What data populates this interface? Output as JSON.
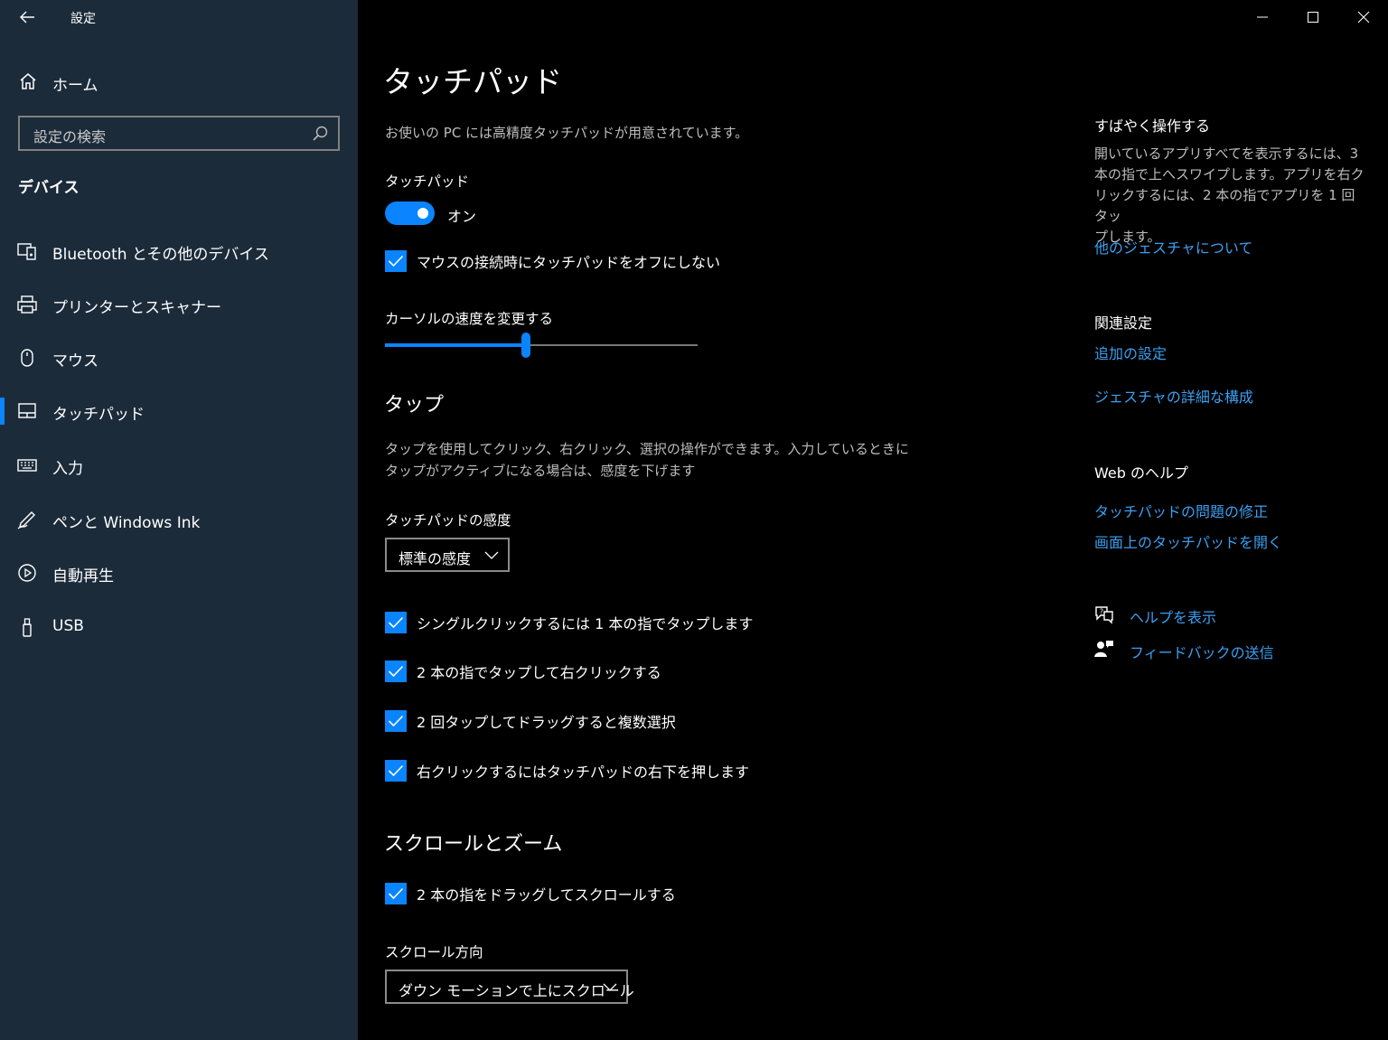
{
  "window": {
    "app_title": "設定"
  },
  "sidebar": {
    "home_label": "ホーム",
    "search_placeholder": "設定の検索",
    "section_title": "デバイス",
    "items": [
      {
        "label": "Bluetooth とその他のデバイス",
        "icon": "bluetooth-device-icon"
      },
      {
        "label": "プリンターとスキャナー",
        "icon": "printer-icon"
      },
      {
        "label": "マウス",
        "icon": "mouse-icon"
      },
      {
        "label": "タッチパッド",
        "icon": "touchpad-icon",
        "selected": true
      },
      {
        "label": "入力",
        "icon": "keyboard-icon"
      },
      {
        "label": "ペンと Windows Ink",
        "icon": "pen-icon"
      },
      {
        "label": "自動再生",
        "icon": "autoplay-icon"
      },
      {
        "label": "USB",
        "icon": "usb-icon"
      }
    ]
  },
  "main": {
    "title": "タッチパッド",
    "precision_note": "お使いの PC には高精度タッチパッドが用意されています。",
    "touchpad_label": "タッチパッド",
    "toggle_state": "オン",
    "keep_on_with_mouse": "マウスの接続時にタッチパッドをオフにしない",
    "cursor_speed_label": "カーソルの速度を変更する",
    "cursor_speed_fraction": 0.45,
    "taps": {
      "heading": "タップ",
      "desc_line1": "タップを使用してクリック、右クリック、選択の操作ができます。入力しているときに",
      "desc_line2": "タップがアクティブになる場合は、感度を下げます",
      "sensitivity_label": "タッチパッドの感度",
      "sensitivity_value": "標準の感度",
      "options": [
        "シングルクリックするには 1 本の指でタップします",
        "2 本の指でタップして右クリックする",
        "2 回タップしてドラッグすると複数選択",
        "右クリックするにはタッチパッドの右下を押します"
      ]
    },
    "scroll": {
      "heading": "スクロールとズーム",
      "two_finger_scroll": "2 本の指をドラッグしてスクロールする",
      "direction_label": "スクロール方向",
      "direction_value": "ダウン モーションで上にスクロール"
    }
  },
  "right_panel": {
    "quick_heading": "すばやく操作する",
    "quick_desc": [
      "開いているアプリすべてを表示するには、3",
      "本の指で上へスワイプします。アプリを右ク",
      "リックするには、2 本の指でアプリを 1 回タッ",
      "プします。"
    ],
    "gestures_link": "他のジェスチャについて",
    "related_heading": "関連設定",
    "additional_settings": "追加の設定",
    "gesture_config": "ジェスチャの詳細な構成",
    "web_help_heading": "Web のヘルプ",
    "fix_touchpad": "タッチパッドの問題の修正",
    "onscreen_touchpad": "画面上のタッチパッドを開く",
    "show_help": "ヘルプを表示",
    "send_feedback": "フィードバックの送信"
  },
  "colors": {
    "sidebar_bg": "#1c2b3a",
    "main_bg": "#000000",
    "accent": "#0a84ff",
    "link": "#3b9ff0"
  }
}
